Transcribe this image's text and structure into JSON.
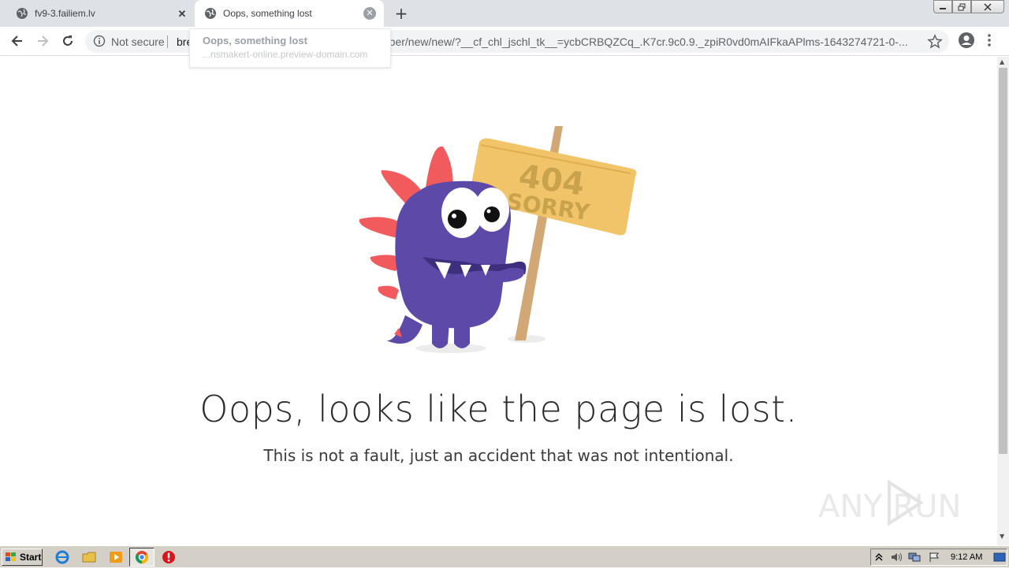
{
  "browser": {
    "tabs": [
      {
        "title": "fv9-3.failiem.lv",
        "active": false
      },
      {
        "title": "Oops, something lost",
        "active": true
      }
    ],
    "new_tab_label": "+",
    "address": {
      "security": "Not secure",
      "host_fragment": "bre",
      "url_tail": "etber/new/new/?__cf_chl_jschl_tk__=ycbCRBQZCq_.K7cr.9c0.9._zpiR0vd0mAIFkaAPlms-1643274721-0-..."
    },
    "hovercard": {
      "title": "Oops, something lost",
      "domain": "...nsmakert-online.preview-domain.com"
    }
  },
  "page": {
    "sign_line1": "404",
    "sign_line2": "SORRY",
    "headline": "Oops, looks like the page is lost.",
    "subline": "This is not a fault, just an accident that was not intentional.",
    "watermark": "ANY RUN"
  },
  "taskbar": {
    "start_label": "Start",
    "clock": "9:12 AM"
  },
  "icons": {
    "globe": "globe-icon",
    "back": "back-arrow-icon",
    "forward": "forward-arrow-icon",
    "reload": "reload-icon",
    "info": "info-icon",
    "star": "star-icon",
    "profile": "profile-icon"
  },
  "colors": {
    "monster": "#5d4aa8",
    "spikes": "#f15b5e",
    "sign": "#f2c46a",
    "post": "#d1a775"
  }
}
